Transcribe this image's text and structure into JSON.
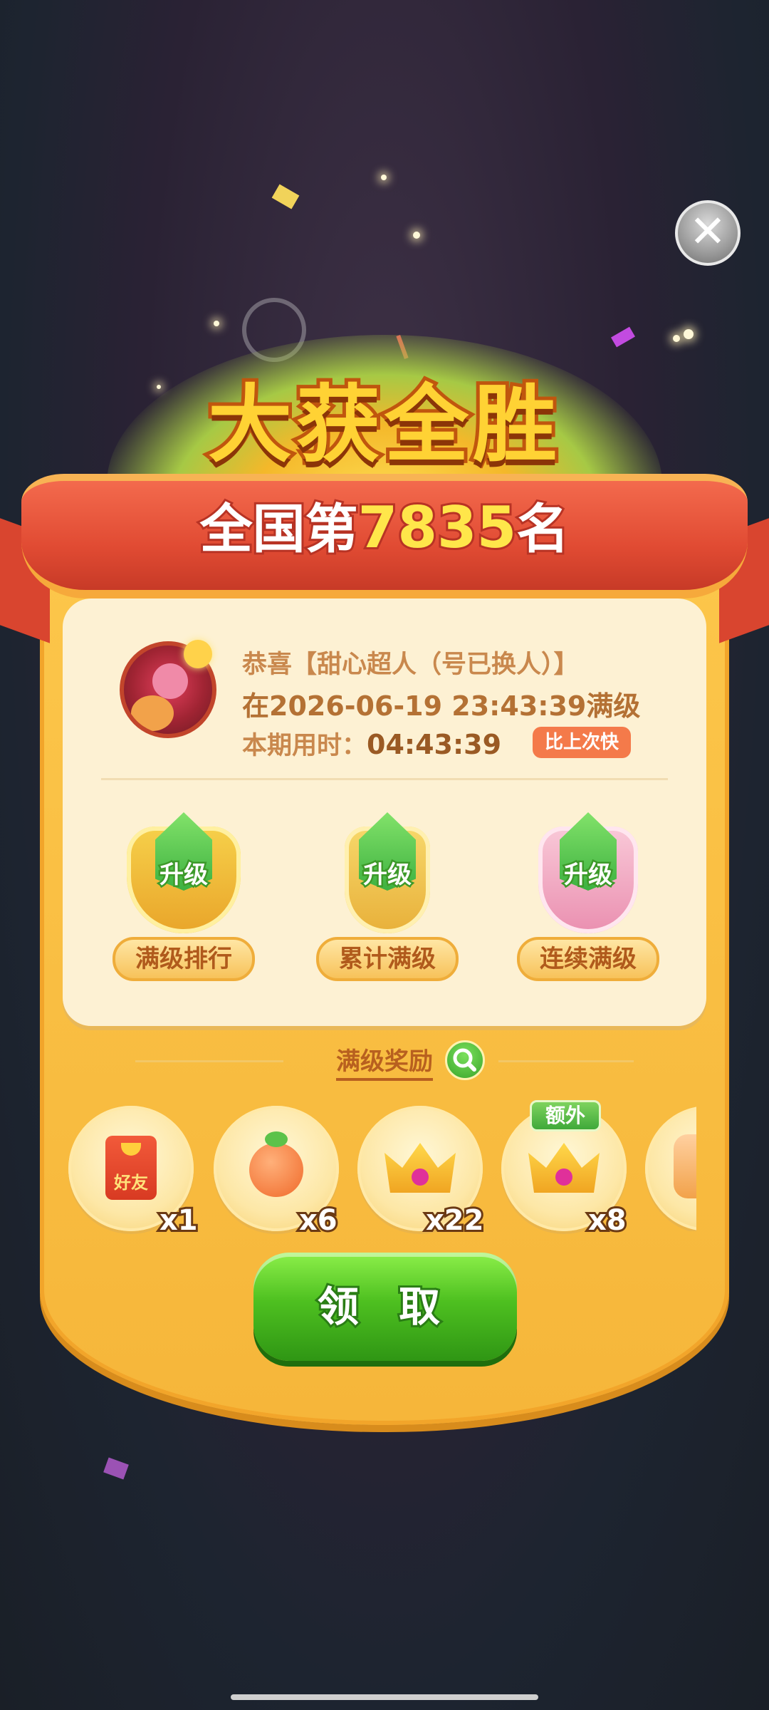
{
  "screen": {
    "title": "大获全胜",
    "close_icon": "close-icon"
  },
  "ranking": {
    "prefix": "全国第",
    "rank": "7835",
    "suffix": "名"
  },
  "player": {
    "line1": "恭喜【甜心超人（号已换人）】",
    "line2": "在2026-06-19 23:43:39满级",
    "time_label": "本期用时：",
    "time_value": "04:43:39",
    "badge": "比上次快"
  },
  "badges": [
    {
      "up": "升级",
      "label": "满级排行"
    },
    {
      "up": "升级",
      "label": "累计满级"
    },
    {
      "up": "升级",
      "label": "连续满级"
    }
  ],
  "rewards": {
    "title": "满级奖励",
    "items": [
      {
        "icon": "friend-red-packet-icon",
        "text": "好友",
        "qty": "x1"
      },
      {
        "icon": "magic-wand-icon",
        "qty": "x6"
      },
      {
        "icon": "crown-icon",
        "qty": "x22"
      },
      {
        "icon": "crown-icon",
        "qty": "x8",
        "tag": "额外"
      },
      {
        "icon": "partial-reward-icon"
      }
    ]
  },
  "claim_button": "领 取",
  "colors": {
    "accent_green": "#4ec020",
    "ribbon": "#e14b33",
    "panel": "#f6b63a"
  }
}
